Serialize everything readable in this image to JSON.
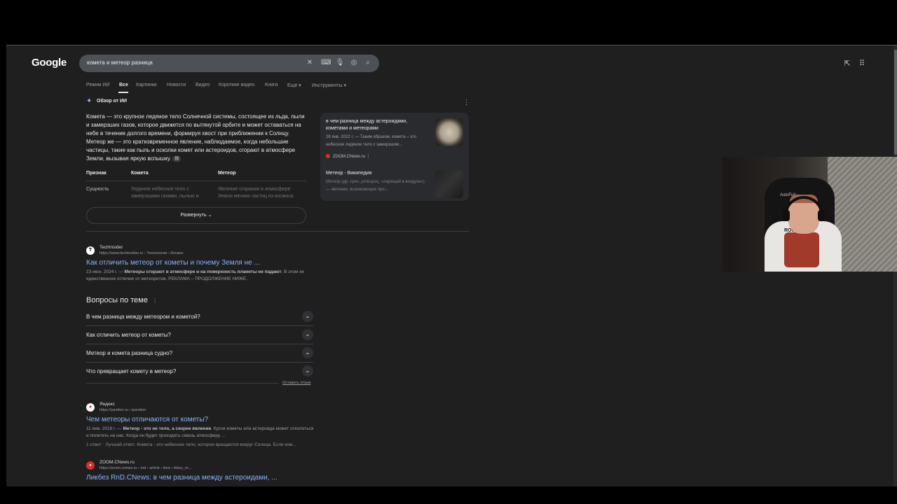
{
  "google": {
    "logo": "Google"
  },
  "search": {
    "query": "комета и метеор разница"
  },
  "tabs": [
    "Режим ИИ",
    "Все",
    "Картинки",
    "Новости",
    "Видео",
    "Короткие видео",
    "Книги",
    "Ещё ▾",
    "Инструменты ▾"
  ],
  "ai_overview": {
    "heading": "Обзор от ИИ",
    "text": "Комета — это крупное ледяное тело Солнечной системы, состоящее из льда, пыли и замерзших газов, которое движется по вытянутой орбите и может оставаться на небе в течение долгого времени, формируя хвост при приближении к Солнцу. Метеор же — это кратковременное явление, наблюдаемое, когда небольшие частицы, такие как пыль и осколки комет или астероидов, сгорают в атмосфере Земли, вызывая яркую вспышку.",
    "table": {
      "headers": [
        "Признак",
        "Комета",
        "Метеор"
      ],
      "row_label": "Сущность",
      "comet_cell": "Ледяное небесное тело с замерзшими газами, пылью и",
      "meteor_cell": "Явление сгорания в атмосфере Земли мелких частиц из космоса"
    },
    "expand_label": "Развернуть",
    "cards": [
      {
        "title": "в чем разница между астероидами, кометами и метеорами",
        "snippet": "28 янв. 2022 г. — Таким образом, комета – это небесное ледяное тело с замерзшим...",
        "source": "ZOOM.CNews.ru"
      },
      {
        "title": "Метеор - Википедия",
        "snippet": "Метео́р (др.-греч. μετέωρος, «парящий в воздухе») — явление, возникающее при...",
        "source": ""
      }
    ]
  },
  "results": [
    {
      "site": "TechInsider",
      "url": "https://www.techinsider.ru › Технологии › Космос",
      "title": "Как отличить метеор от кометы и почему Земля не ...",
      "date": "23 июн. 2024 г. — ",
      "snippet_bold": "Метеоры сгорают в атмосфере и на поверхность планеты не падают",
      "snippet_rest": ". В этом их единственное отличие от метеоритов. РЕКЛАМА – ПРОДОЛЖЕНИЕ НИЖЕ."
    },
    {
      "site": "Яндекс",
      "url": "https://yandex.ru › question",
      "title": "Чем метеоры отличаются от кометы?",
      "date": "11 янв. 2018 г. — ",
      "snippet_bold": "Метеор - это не тело, а скорее явление",
      "snippet_rest": ". Кусок кометы или астероида может отколоться и полететь на нас. Когда он будет проходить сквозь атмосферу ...",
      "extra": "1 ответ · Лучший ответ: Комета - это небесное тело, которое вращается вокруг Солнца. Если ком..."
    },
    {
      "site": "ZOOM.CNews.ru",
      "url": "https://zoom.cnews.ru › rnd › article › item › ikbez_m...",
      "title": "Ликбез RnD.CNews: в чем разница между астероидами, ..."
    }
  ],
  "paa": {
    "heading": "Вопросы по теме",
    "questions": [
      "В чем разница между метеором и кометой?",
      "Как отличить метеор от кометы?",
      "Метеор и комета разница судно?",
      "Что превращает комету в метеор?"
    ],
    "feedback": "Оставить отзыв"
  },
  "webcam": {
    "chair_brand": "AutoFull",
    "shirt_text": "ROCKETBOY"
  },
  "colors": {
    "background": "#1f1f1f",
    "link": "#8ab4f8",
    "text": "#bdc1c6"
  }
}
